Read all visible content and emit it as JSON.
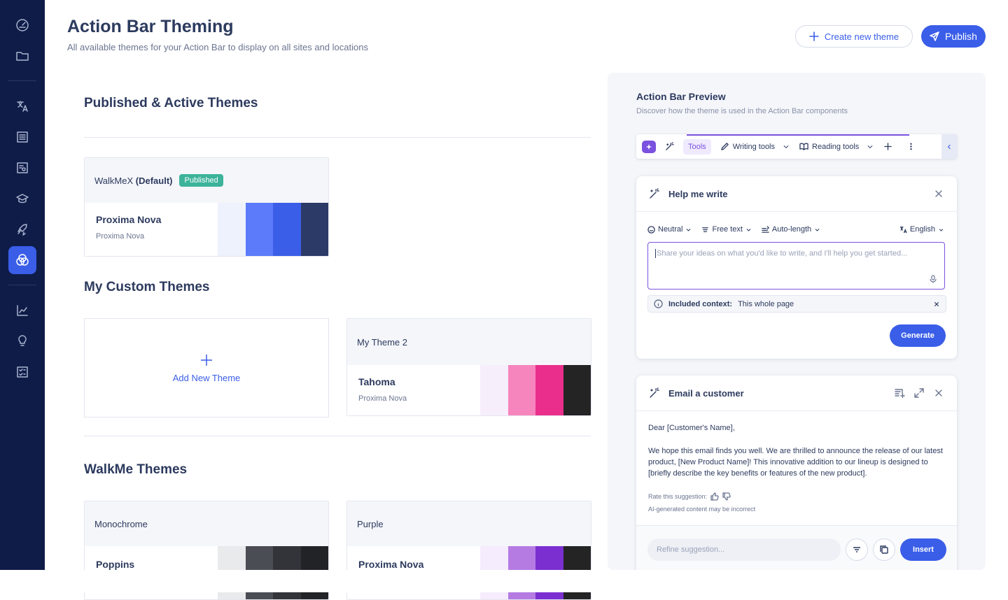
{
  "header": {
    "title": "Action Bar Theming",
    "subtitle": "All available themes for your Action Bar to display on all sites and locations",
    "create_label": "Create new theme",
    "publish_label": "Publish"
  },
  "sidebar": {
    "icons": [
      "dashboard-icon",
      "folder-icon",
      "translate-icon",
      "list-icon",
      "workflow-icon",
      "graduation-cap-icon",
      "rocket-icon",
      "themes-icon",
      "analytics-icon",
      "lightbulb-icon",
      "checklist-icon"
    ],
    "active": "themes-icon"
  },
  "colors": {
    "sidebar_bg": "#0f1c48",
    "accent": "#3a5ee8",
    "published_badge": "#3cb39a",
    "ai_purple": "#7b52e0"
  },
  "sections": {
    "published": "Published & Active Themes",
    "custom": "My Custom Themes",
    "walkme": "WalkMe Themes"
  },
  "published_theme": {
    "name": "WalkMeX",
    "default_label": "(Default)",
    "badge": "Published",
    "font": "Proxima Nova",
    "font_sub": "Proxima Nova",
    "swatches": [
      "#eef2fd",
      "#5b7bfa",
      "#3a5ee8",
      "#2c3a68"
    ]
  },
  "add_theme_label": "Add New Theme",
  "custom_themes": [
    {
      "name": "My Theme 2",
      "font": "Tahoma",
      "font_sub": "Proxima Nova",
      "swatches": [
        "#f7eefb",
        "#f785bd",
        "#ea2e8c",
        "#242424"
      ]
    }
  ],
  "walkme_themes": [
    {
      "name": "Monochrome",
      "font": "Poppins",
      "swatches": [
        "#e9eaec",
        "#4b4d54",
        "#333439",
        "#222326"
      ]
    },
    {
      "name": "Purple",
      "font": "Proxima Nova",
      "swatches": [
        "#f5ecfd",
        "#b57be3",
        "#7b2fd0",
        "#242424"
      ]
    }
  ],
  "preview": {
    "title": "Action Bar Preview",
    "subtitle": "Discover how the theme is used in the Action Bar components",
    "toolbar": {
      "tools": "Tools",
      "writing": "Writing tools",
      "reading": "Reading tools"
    },
    "help_write": {
      "title": "Help me write",
      "tone": "Neutral",
      "format": "Free text",
      "length": "Auto-length",
      "language": "English",
      "placeholder": "Share your ideas on what you'd like to write, and I'll help you get started...",
      "context_label": "Included context:",
      "context_value": "This whole page",
      "generate": "Generate"
    },
    "email": {
      "title": "Email a customer",
      "greeting": "Dear [Customer's Name],",
      "body": "We hope this email finds you well. We are thrilled to announce the release of our latest product, [New Product Name]! This innovative addition to our lineup is designed to [briefly describe the key benefits or features of the new product].",
      "rate": "Rate this suggestion:",
      "ai_note": "AI-generated content may be incorrect",
      "refine_placeholder": "Refine suggestion...",
      "insert": "Insert"
    }
  }
}
